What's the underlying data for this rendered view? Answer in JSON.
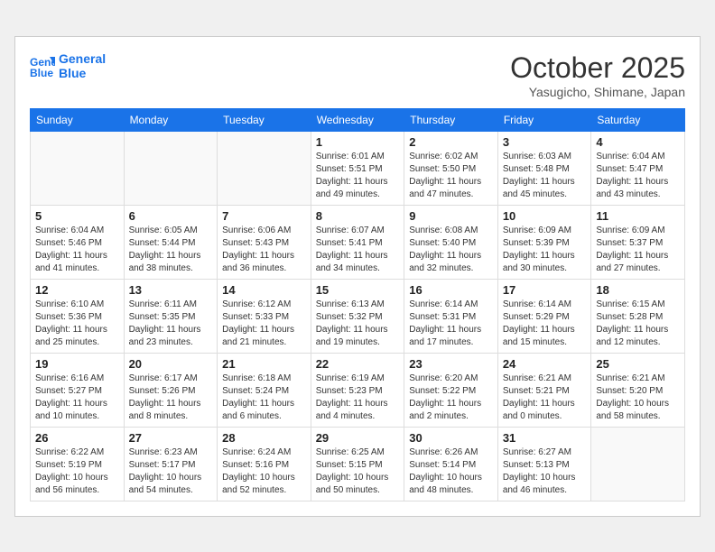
{
  "header": {
    "logo_line1": "General",
    "logo_line2": "Blue",
    "month_title": "October 2025",
    "location": "Yasugicho, Shimane, Japan"
  },
  "weekdays": [
    "Sunday",
    "Monday",
    "Tuesday",
    "Wednesday",
    "Thursday",
    "Friday",
    "Saturday"
  ],
  "weeks": [
    [
      {
        "day": "",
        "info": ""
      },
      {
        "day": "",
        "info": ""
      },
      {
        "day": "",
        "info": ""
      },
      {
        "day": "1",
        "info": "Sunrise: 6:01 AM\nSunset: 5:51 PM\nDaylight: 11 hours\nand 49 minutes."
      },
      {
        "day": "2",
        "info": "Sunrise: 6:02 AM\nSunset: 5:50 PM\nDaylight: 11 hours\nand 47 minutes."
      },
      {
        "day": "3",
        "info": "Sunrise: 6:03 AM\nSunset: 5:48 PM\nDaylight: 11 hours\nand 45 minutes."
      },
      {
        "day": "4",
        "info": "Sunrise: 6:04 AM\nSunset: 5:47 PM\nDaylight: 11 hours\nand 43 minutes."
      }
    ],
    [
      {
        "day": "5",
        "info": "Sunrise: 6:04 AM\nSunset: 5:46 PM\nDaylight: 11 hours\nand 41 minutes."
      },
      {
        "day": "6",
        "info": "Sunrise: 6:05 AM\nSunset: 5:44 PM\nDaylight: 11 hours\nand 38 minutes."
      },
      {
        "day": "7",
        "info": "Sunrise: 6:06 AM\nSunset: 5:43 PM\nDaylight: 11 hours\nand 36 minutes."
      },
      {
        "day": "8",
        "info": "Sunrise: 6:07 AM\nSunset: 5:41 PM\nDaylight: 11 hours\nand 34 minutes."
      },
      {
        "day": "9",
        "info": "Sunrise: 6:08 AM\nSunset: 5:40 PM\nDaylight: 11 hours\nand 32 minutes."
      },
      {
        "day": "10",
        "info": "Sunrise: 6:09 AM\nSunset: 5:39 PM\nDaylight: 11 hours\nand 30 minutes."
      },
      {
        "day": "11",
        "info": "Sunrise: 6:09 AM\nSunset: 5:37 PM\nDaylight: 11 hours\nand 27 minutes."
      }
    ],
    [
      {
        "day": "12",
        "info": "Sunrise: 6:10 AM\nSunset: 5:36 PM\nDaylight: 11 hours\nand 25 minutes."
      },
      {
        "day": "13",
        "info": "Sunrise: 6:11 AM\nSunset: 5:35 PM\nDaylight: 11 hours\nand 23 minutes."
      },
      {
        "day": "14",
        "info": "Sunrise: 6:12 AM\nSunset: 5:33 PM\nDaylight: 11 hours\nand 21 minutes."
      },
      {
        "day": "15",
        "info": "Sunrise: 6:13 AM\nSunset: 5:32 PM\nDaylight: 11 hours\nand 19 minutes."
      },
      {
        "day": "16",
        "info": "Sunrise: 6:14 AM\nSunset: 5:31 PM\nDaylight: 11 hours\nand 17 minutes."
      },
      {
        "day": "17",
        "info": "Sunrise: 6:14 AM\nSunset: 5:29 PM\nDaylight: 11 hours\nand 15 minutes."
      },
      {
        "day": "18",
        "info": "Sunrise: 6:15 AM\nSunset: 5:28 PM\nDaylight: 11 hours\nand 12 minutes."
      }
    ],
    [
      {
        "day": "19",
        "info": "Sunrise: 6:16 AM\nSunset: 5:27 PM\nDaylight: 11 hours\nand 10 minutes."
      },
      {
        "day": "20",
        "info": "Sunrise: 6:17 AM\nSunset: 5:26 PM\nDaylight: 11 hours\nand 8 minutes."
      },
      {
        "day": "21",
        "info": "Sunrise: 6:18 AM\nSunset: 5:24 PM\nDaylight: 11 hours\nand 6 minutes."
      },
      {
        "day": "22",
        "info": "Sunrise: 6:19 AM\nSunset: 5:23 PM\nDaylight: 11 hours\nand 4 minutes."
      },
      {
        "day": "23",
        "info": "Sunrise: 6:20 AM\nSunset: 5:22 PM\nDaylight: 11 hours\nand 2 minutes."
      },
      {
        "day": "24",
        "info": "Sunrise: 6:21 AM\nSunset: 5:21 PM\nDaylight: 11 hours\nand 0 minutes."
      },
      {
        "day": "25",
        "info": "Sunrise: 6:21 AM\nSunset: 5:20 PM\nDaylight: 10 hours\nand 58 minutes."
      }
    ],
    [
      {
        "day": "26",
        "info": "Sunrise: 6:22 AM\nSunset: 5:19 PM\nDaylight: 10 hours\nand 56 minutes."
      },
      {
        "day": "27",
        "info": "Sunrise: 6:23 AM\nSunset: 5:17 PM\nDaylight: 10 hours\nand 54 minutes."
      },
      {
        "day": "28",
        "info": "Sunrise: 6:24 AM\nSunset: 5:16 PM\nDaylight: 10 hours\nand 52 minutes."
      },
      {
        "day": "29",
        "info": "Sunrise: 6:25 AM\nSunset: 5:15 PM\nDaylight: 10 hours\nand 50 minutes."
      },
      {
        "day": "30",
        "info": "Sunrise: 6:26 AM\nSunset: 5:14 PM\nDaylight: 10 hours\nand 48 minutes."
      },
      {
        "day": "31",
        "info": "Sunrise: 6:27 AM\nSunset: 5:13 PM\nDaylight: 10 hours\nand 46 minutes."
      },
      {
        "day": "",
        "info": ""
      }
    ]
  ]
}
